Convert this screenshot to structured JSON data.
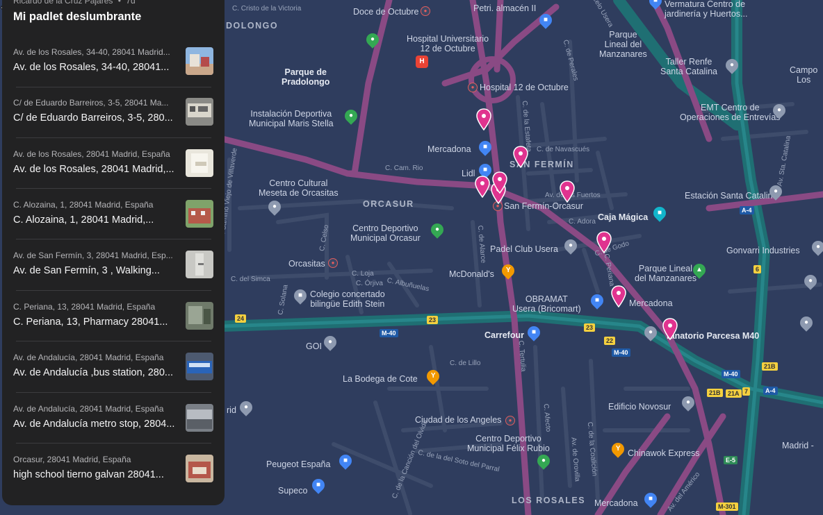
{
  "panel": {
    "author": "Ricardo de la Cruz Pajares",
    "age": "7d",
    "title": "Mi padlet deslumbrante",
    "items": [
      {
        "subtitle": "Av. de los Rosales, 34-40, 28041 Madrid...",
        "title": "Av. de los Rosales, 34-40, 28041..."
      },
      {
        "subtitle": "C/ de Eduardo Barreiros, 3-5, 28041 Ma...",
        "title": "C/ de Eduardo Barreiros, 3-5, 280..."
      },
      {
        "subtitle": "Av. de los Rosales, 28041 Madrid, España",
        "title": "Av. de los Rosales, 28041 Madrid,..."
      },
      {
        "subtitle": "C. Alozaina, 1, 28041 Madrid, España",
        "title": "C. Alozaina, 1, 28041 Madrid,..."
      },
      {
        "subtitle": "Av. de San Fermín, 3, 28041 Madrid, Esp...",
        "title": "Av. de San Fermín, 3 , Walking..."
      },
      {
        "subtitle": "C. Periana, 13, 28041 Madrid, España",
        "title": "C. Periana, 13, Pharmacy 28041..."
      },
      {
        "subtitle": "Av. de Andalucía, 28041 Madrid, España",
        "title": "Av. de Andalucía ,bus station, 280..."
      },
      {
        "subtitle": "Av. de Andalucía, 28041 Madrid, España",
        "title": "Av. de Andalucía metro stop, 2804..."
      },
      {
        "subtitle": "Orcasur, 28041 Madrid, España",
        "title": "high school tierno galvan 28041..."
      }
    ]
  },
  "map": {
    "districts": {
      "dolongo": "DOLONGO",
      "san_fermin": "SAN FERMÍN",
      "orcasur": "ORCASUR",
      "los_rosales": "LOS ROSALES"
    },
    "places": {
      "cristo_victoria": "C. Cristo de la Victoria",
      "doce_octubre_top": "Doce de Octubre",
      "petri": "Petri. almacén II",
      "vermatura": "Vermatura Centro de\njardinería y Huertos...",
      "hospital_uni": "Hospital Universitario\n12 de Octubre",
      "parque_lineal_manz": "Parque\nLineal del\nManzanares",
      "taller_renfe": "Taller Renfe\nSanta Catalina",
      "campo": "Campo\nLos",
      "parque_pradolongo": "Parque de\nPradolongo",
      "hospital_12": "Hospital 12 de Octubre",
      "emt": "EMT Centro de\nOperaciones de Entrevías",
      "instalacion": "Instalación Deportiva\nMunicipal Maris Stella",
      "mercadona1": "Mercadona",
      "lidl": "Lidl",
      "centro_cultural": "Centro Cultural\nMeseta de Orcasitas",
      "san_fermin_orcasur": "San Fermín-Orcasur",
      "estacion_sc": "Estación Santa Catalina",
      "caja_magica": "Caja Mágica",
      "centro_dep_orcasur": "Centro Deportivo\nMunicipal Orcasur",
      "padel_club": "Padel Club Usera",
      "gonvarri": "Gonvarri Industries",
      "orcasitas": "Orcasitas",
      "mcdonalds": "McDonald's",
      "parque_lineal2": "Parque Lineal\ndel Manzanares",
      "colegio": "Colegio concertado\nbilingüe Edith Stein",
      "obramat": "OBRAMAT\nUsera (Bricomart)",
      "mercadona2": "Mercadona",
      "carrefour": "Carrefour",
      "tanatorio": "Tanatorio Parcesa M40",
      "goi": "GOI",
      "la_bodega": "La Bodega de Cote",
      "edificio_novosur": "Edificio Novosur",
      "rid": "rid",
      "ciudad_angeles": "Ciudad de los Angeles",
      "centro_dep_felix": "Centro Deportivo\nMunicipal Félix Rubio",
      "chinawok": "Chinawok Express",
      "madrid": "Madrid -",
      "peugeot": "Peugeot España",
      "supeco": "Supeco",
      "mercadona3": "Mercadona"
    },
    "streets": {
      "cam_rio": "C. Cam. Rio",
      "navascues": "C. de Navascués",
      "fuertos": "Av. de los Fuertos",
      "adora": "C. Adora",
      "godo": "C. de Godo",
      "simca": "C. del Simca",
      "loja": "C. Loja",
      "orjiva": "C. Órjiva",
      "albunuelas": "C. Albuñuelas",
      "lillo": "C. de Lillo",
      "solana": "C. Solana",
      "celso": "C. Celso",
      "alarce": "C. de Alarce",
      "cam_viejo": "C. del Camino Viejo de Villaverde",
      "estafeta": "C. de la Estafeta",
      "perales": "C. de Perales",
      "periana": "C. Periana",
      "tertulia": "C. Tertulia",
      "afecto": "C. Afecto",
      "orovilla": "Av. de Orovilla",
      "coalicion": "C. de la Coalición",
      "cancion_olvido": "C. de la Canción del Olvido",
      "soto_parral": "C. de la del Soto del Parral",
      "americo": "Av. del Américo",
      "santa_catalina": "Av. Sta. Catalina",
      "marcelo_usera": "C. de Marcelo Usera"
    },
    "road_shields": [
      "24",
      "M-40",
      "23",
      "23",
      "22",
      "M-40",
      "21B",
      "M-40",
      "21B",
      "21A",
      "7",
      "A-4",
      "A-4",
      "6",
      "E-5",
      "M-301"
    ],
    "colors": {
      "background": "#2f3d5e",
      "primary_road": "#8a4a84",
      "highway": "#1f6f73",
      "minor_road": "#3f4d6c",
      "padlet_pin": "#e0338f",
      "panel": "#222223"
    }
  }
}
